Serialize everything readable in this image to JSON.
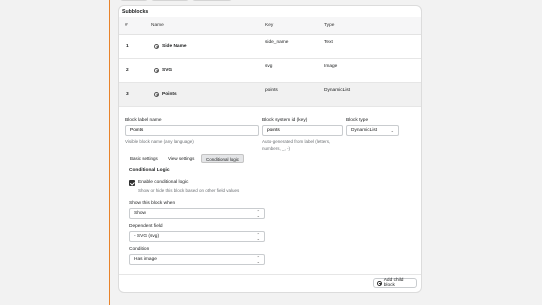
{
  "section_title": "Subblocks",
  "table": {
    "headers": [
      "#",
      "Name",
      "Key",
      "Type"
    ],
    "rows": [
      {
        "num": "1",
        "name": "Side Name",
        "key": "side_name",
        "type": "Text"
      },
      {
        "num": "2",
        "name": "SVG",
        "key": "svg",
        "type": "Image"
      },
      {
        "num": "3",
        "name": "Points",
        "key": "points",
        "type": "DynamicList"
      }
    ]
  },
  "editor": {
    "label_title": "Block label name",
    "label_value": "Points",
    "label_help": "Visible block name (any language)",
    "system_title": "Block system id (key)",
    "system_value": "points",
    "system_help": "Auto-generated from label (letters, numbers, _, -)",
    "type_title": "Block type",
    "type_value": "DynamicList",
    "tabs": [
      "Basic settings",
      "View settings",
      "Conditional logic"
    ],
    "cond_title": "Conditional Logic",
    "enable_label": "Enable conditional logic",
    "enable_help": "Show or hide this block based on other field values",
    "show_when_label": "Show this block when",
    "show_when_value": "Show",
    "dependent_label": "Dependent field",
    "dependent_value": "- SVG (svg)",
    "condition_label": "Condition",
    "condition_value": "Has image"
  },
  "add_child_label": "Add child block",
  "colors": {
    "accent_line": "#e8832a",
    "checkbox": "#303030"
  }
}
